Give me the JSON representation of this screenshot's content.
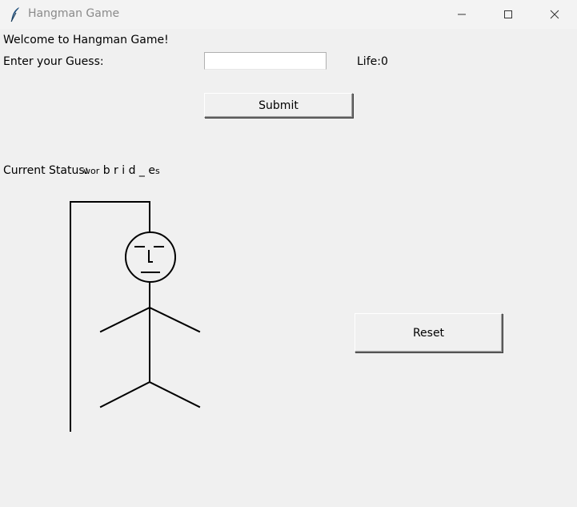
{
  "window": {
    "title": "Hangman Game",
    "icon": "feather-icon"
  },
  "welcome_text": "Welcome to Hangman Game!",
  "guess_label": "Enter your Guess:",
  "guess_value": "",
  "life": "Life:0",
  "submit_label": "Submit",
  "status_label": "Current Status:",
  "status_word_clipped": "wor",
  "status_word": "b r i d _ e",
  "status_word_tail": "s",
  "reset_label": "Reset"
}
